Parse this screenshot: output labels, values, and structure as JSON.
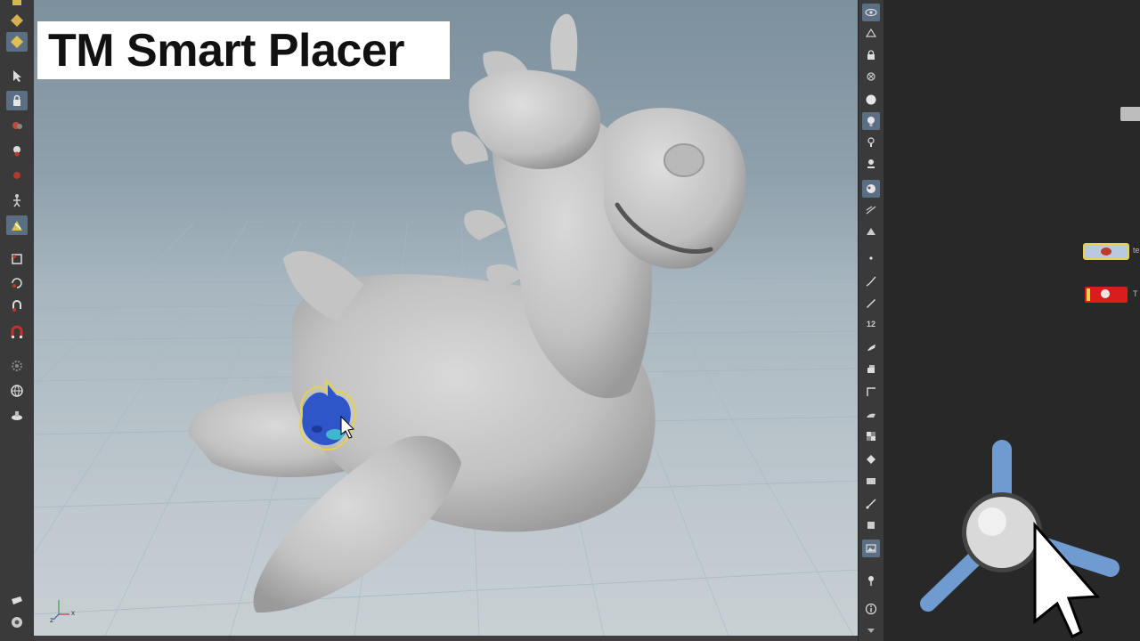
{
  "overlay": {
    "title": "TM Smart Placer"
  },
  "viewport": {
    "axis_label_x": "x",
    "axis_label_z": "z"
  },
  "right_toolbar": {
    "snap_label": "12"
  },
  "network": {
    "nodes": [
      {
        "label": "te",
        "color": "#e8d24a",
        "selected": true
      },
      {
        "label": "T",
        "color": "#d81d1d",
        "selected": false
      }
    ]
  },
  "colors": {
    "accent": "#5b6f84",
    "node_yellow": "#e8d24a",
    "node_red": "#d81d1d",
    "handle_blue": "#6f9bd1"
  }
}
